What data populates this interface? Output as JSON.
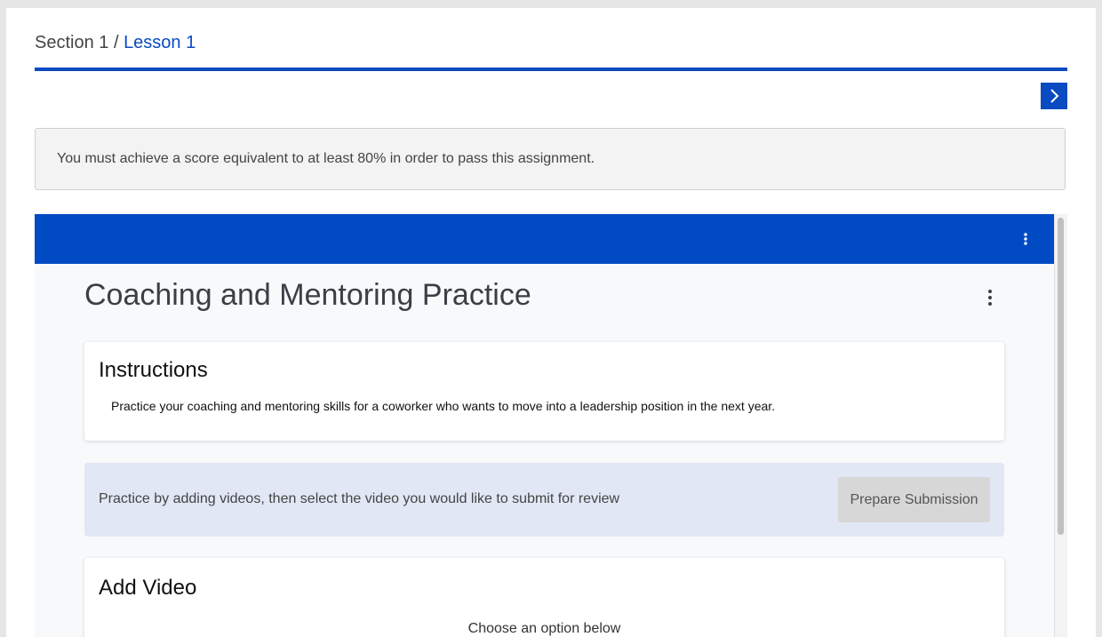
{
  "breadcrumb": {
    "section": "Section 1",
    "separator": " / ",
    "lesson": "Lesson 1"
  },
  "nav": {
    "next_icon": "chevron-right-icon"
  },
  "notice": {
    "text": "You must achieve a score equivalent to at least 80% in order to pass this assignment."
  },
  "activity": {
    "title": "Coaching and Mentoring Practice",
    "instructions": {
      "heading": "Instructions",
      "body": "Practice your coaching and mentoring skills for a coworker who wants to move into a leadership position in the next year."
    },
    "practice": {
      "message": "Practice by adding videos, then select the video you would like to submit for review",
      "button_label": "Prepare Submission"
    },
    "add_video": {
      "heading": "Add Video",
      "subtext": "Choose an option below"
    }
  },
  "colors": {
    "accent": "#0a4bc2",
    "frame_bar": "#004bc4",
    "notice_bg": "#f3f3f3",
    "practice_bg": "#e1e7f5"
  }
}
